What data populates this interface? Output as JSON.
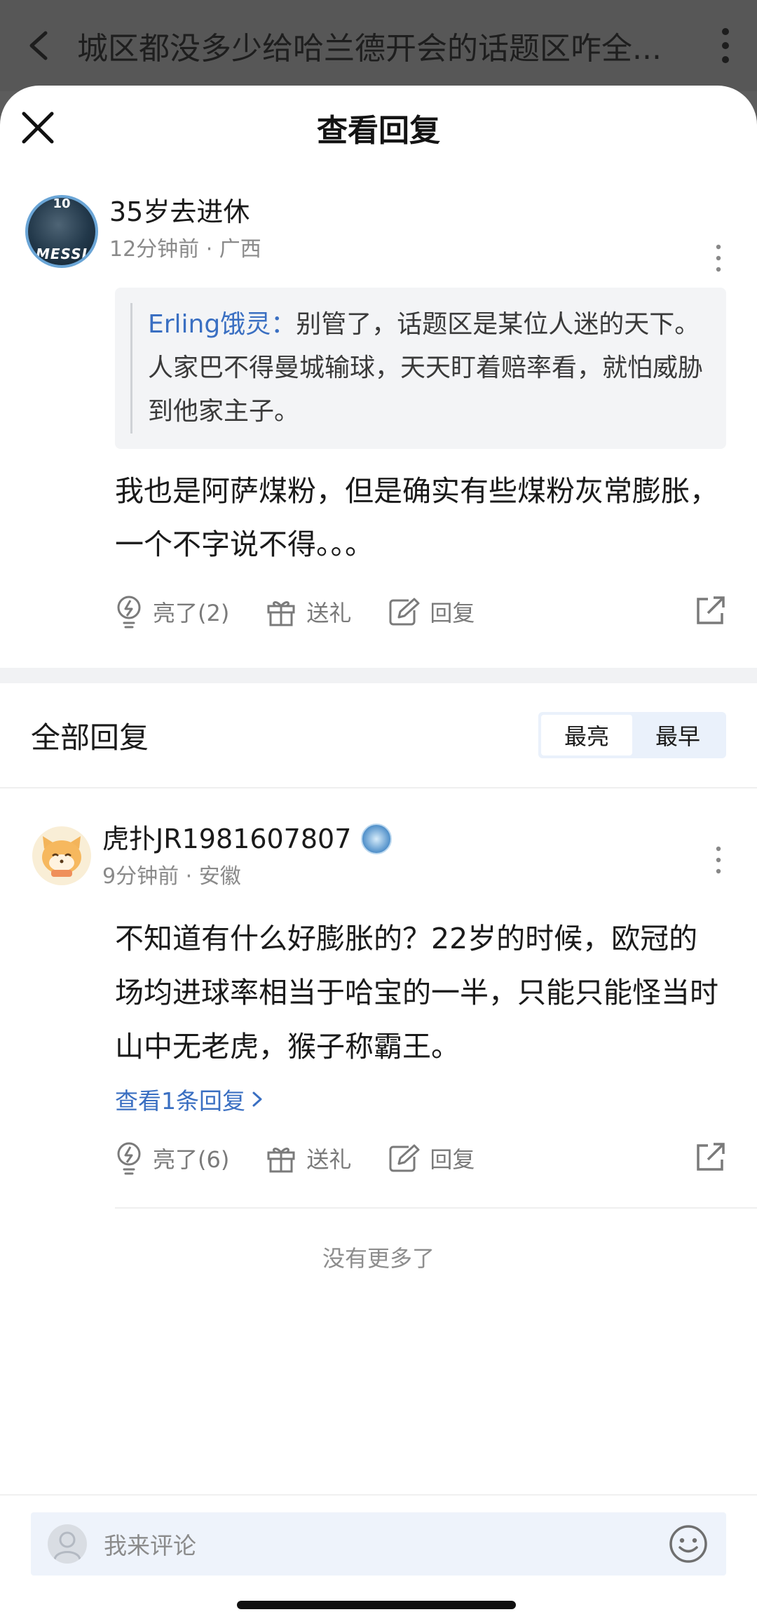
{
  "under_page": {
    "title": "城区都没多少给哈兰德开会的话题区咋全..."
  },
  "sheet": {
    "title": "查看回复"
  },
  "main_comment": {
    "username": "35岁去进休",
    "time_location": "12分钟前 · 广西",
    "avatar_number": "10",
    "avatar_caption": "MESSI",
    "quote_name": "Erling饿灵：",
    "quote_text": "别管了，话题区是某位人迷的天下。人家巴不得曼城输球，天天盯着赔率看，就怕威胁到他家主子。",
    "body": "我也是阿萨煤粉，但是确实有些煤粉灰常膨胀，一个不字说不得。。。",
    "like_label": "亮了(2)",
    "gift_label": "送礼",
    "reply_label": "回复"
  },
  "all_replies": {
    "title": "全部回复",
    "sort_options": [
      "最亮",
      "最早"
    ],
    "sort_selected": "最亮"
  },
  "reply": {
    "username": "虎扑JR1981607807",
    "time_location": "9分钟前 · 安徽",
    "body": "不知道有什么好膨胀的？22岁的时候，欧冠的场均进球率相当于哈宝的一半，只能只能怪当时山中无老虎，猴子称霸王。",
    "view_replies": "查看1条回复",
    "like_label": "亮了(6)",
    "gift_label": "送礼",
    "reply_label": "回复"
  },
  "no_more": "没有更多了",
  "comment_input": {
    "placeholder": "我来评论"
  }
}
